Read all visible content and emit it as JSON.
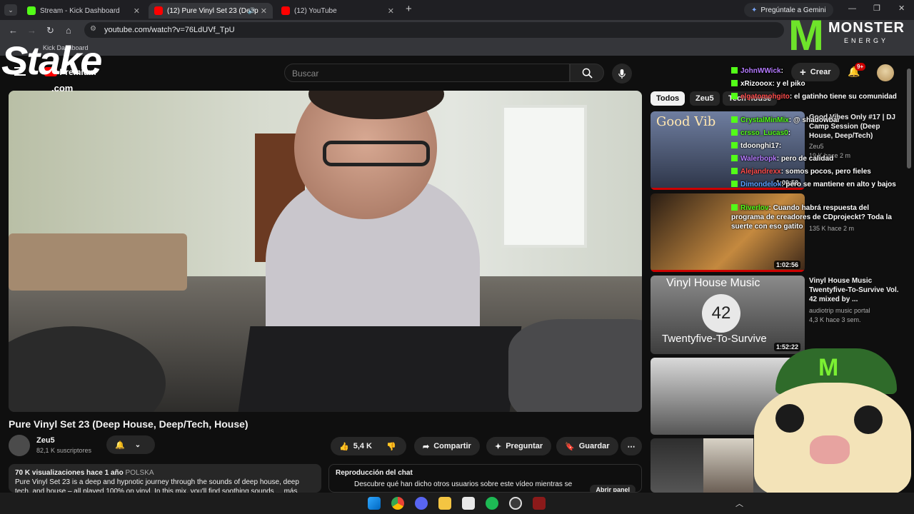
{
  "browser": {
    "tabs": [
      {
        "title": "Stream - Kick Dashboard",
        "color": "#53fc18"
      },
      {
        "title": "(12) Pure Vinyl Set 23 (Deep",
        "color": "#ff0000"
      },
      {
        "title": "(12) YouTube",
        "color": "#ff0000"
      }
    ],
    "gemini_label": "Pregúntale a Gemini",
    "url": "youtube.com/watch?v=76LdUVf_TpU",
    "bookmark": "Kick Dashboard"
  },
  "overlay": {
    "stake_logo": "Stake",
    "stake_sub": ".com",
    "monster_brand": "MONSTER",
    "monster_sub": "ENERGY"
  },
  "youtube": {
    "logo_text": "Premium",
    "search_placeholder": "Buscar",
    "create_label": "Crear",
    "notif_badge": "9+",
    "video": {
      "title": "Pure Vinyl Set 23 (Deep House, Deep/Tech, House)",
      "channel": "Zeu5",
      "subscribers": "82,1 K suscriptores",
      "likes": "5,4 K",
      "share_label": "Compartir",
      "ask_label": "Preguntar",
      "save_label": "Guardar",
      "stats": "70 K visualizaciones  hace 1 año",
      "location": "POLSKA",
      "description": "Pure Vinyl Set 23 is a deep and hypnotic journey through the sounds of deep house, deep",
      "description2": "tech, and house – all played 100% on vinyl. In this mix, you'll find soothing sounds ... más"
    },
    "chat_replay": {
      "title": "Reproducción del chat",
      "text": "Descubre qué han dicho otros usuarios sobre este vídeo mientras se",
      "button": "Abrir panel"
    },
    "chips": [
      "Todos",
      "Zeu5",
      "Tech house"
    ],
    "sidebar": [
      {
        "title": "Good Vibes Only #17 | DJ Camp Session (Deep House, Deep/Tech)",
        "channel": "Zeu5",
        "meta": "19 K  hace 2 m",
        "duration": "1:00:58"
      },
      {
        "title": "",
        "channel": "",
        "meta": "135 K  hace 2 m",
        "duration": "1:02:56"
      },
      {
        "title": "Vinyl House Music Twentyfive-To-Survive Vol. 42 mixed by ...",
        "channel": "audiotrip music portal",
        "meta": "4,3 K  hace 3 sem.",
        "duration": "1:52:22",
        "thumb_top": "Vinyl House Music",
        "thumb_num": "42",
        "thumb_bottom": "Twentyfive-To-Survive"
      },
      {
        "title": "",
        "channel": "",
        "meta": "",
        "duration": ""
      }
    ],
    "thumb1_text": "Good Vib"
  },
  "chat": [
    {
      "user": "JohnWWick",
      "user_color": "#b57bff",
      "msg": ":"
    },
    {
      "user": "xRizooox",
      "user_color": "#ffffff",
      "msg": ": y el piko"
    },
    {
      "user": "elgatomohgito",
      "user_color": "#ff4d4d",
      "msg": ": el gatinho tiene su comunidad"
    },
    {
      "user": "CrystalMinMix",
      "user_color": "#53fc18",
      "msg": ": @ shadowbai"
    },
    {
      "user": "crsso_Lucas0",
      "user_color": "#53fc18",
      "msg": ":"
    },
    {
      "user": "tdoonghi17",
      "user_color": "#ffffff",
      "msg": ":"
    },
    {
      "user": "Walerbopk",
      "user_color": "#b57bff",
      "msg": ": pero de calidad"
    },
    {
      "user": "Alejandrexx",
      "user_color": "#ff4d4d",
      "msg": ": somos pocos, pero fieles"
    },
    {
      "user": "Dimondelox",
      "user_color": "#5aa0ff",
      "msg": ": pero se mantiene en alto y bajos"
    },
    {
      "user": "Riverlov",
      "user_color": "#53fc18",
      "msg": ": Cuando habrá respuesta del programa de creadores de CDprojeckt? Toda la suerte con eso gatito"
    }
  ]
}
